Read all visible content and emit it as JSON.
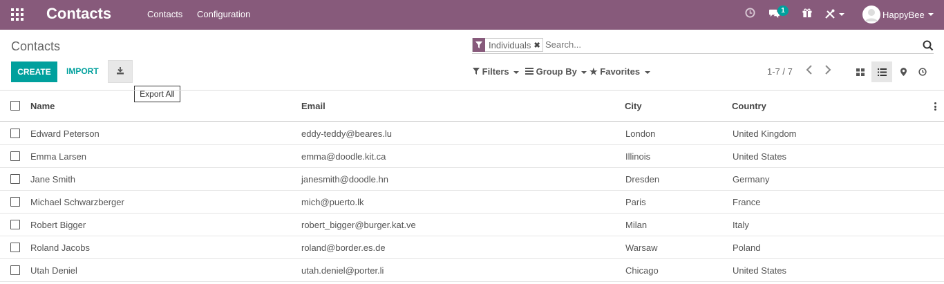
{
  "app": {
    "title": "Contacts",
    "menus": [
      "Contacts",
      "Configuration"
    ],
    "user": "HappyBee",
    "chat_badge": "1"
  },
  "colors": {
    "brand": "#875a7b",
    "accent": "#00a09d"
  },
  "icons": {
    "apps": "grid-icon",
    "activity": "clock-icon",
    "chat": "chat-icon",
    "gift": "gift-icon",
    "debug": "tools-icon",
    "search": "search-icon",
    "export": "download-icon"
  },
  "page": {
    "title": "Contacts"
  },
  "search": {
    "facet": "Individuals",
    "placeholder": "Search..."
  },
  "buttons": {
    "create": "CREATE",
    "import": "IMPORT",
    "export_tooltip": "Export All"
  },
  "filters": {
    "filters": "Filters",
    "group_by": "Group By",
    "favorites": "Favorites"
  },
  "pager": {
    "text": "1-7 / 7"
  },
  "table": {
    "columns": [
      "Name",
      "Email",
      "City",
      "Country"
    ],
    "rows": [
      [
        "Edward Peterson",
        "eddy-teddy@beares.lu",
        "London",
        "United Kingdom"
      ],
      [
        "Emma Larsen",
        "emma@doodle.kit.ca",
        "Illinois",
        "United States"
      ],
      [
        "Jane Smith",
        "janesmith@doodle.hn",
        "Dresden",
        "Germany"
      ],
      [
        "Michael Schwarzberger",
        "mich@puerto.lk",
        "Paris",
        "France"
      ],
      [
        "Robert Bigger",
        "robert_bigger@burger.kat.ve",
        "Milan",
        "Italy"
      ],
      [
        "Roland Jacobs",
        "roland@border.es.de",
        "Warsaw",
        "Poland"
      ],
      [
        "Utah Deniel",
        "utah.deniel@porter.li",
        "Chicago",
        "United States"
      ]
    ]
  }
}
